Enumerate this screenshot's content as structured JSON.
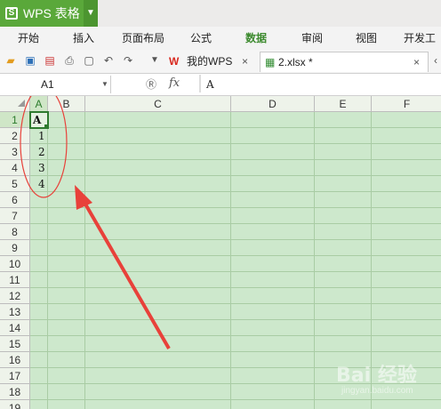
{
  "titlebar": {
    "app_title": "WPS 表格",
    "logo_letter": "S"
  },
  "menu": [
    "开始",
    "插入",
    "页面布局",
    "公式",
    "数据",
    "审阅",
    "视图",
    "开发工具"
  ],
  "menu_active": "数据",
  "toolbar": {
    "tabs": [
      {
        "label": "我的WPS"
      },
      {
        "label": "2.xlsx *"
      }
    ]
  },
  "formula_bar": {
    "name_box": "A1",
    "fx_label": "fx",
    "content": "A"
  },
  "sheet": {
    "columns": [
      "A",
      "B",
      "C",
      "D",
      "E",
      "F"
    ],
    "rows": [
      "1",
      "2",
      "3",
      "4",
      "5",
      "6",
      "7",
      "8",
      "9",
      "10",
      "11",
      "12",
      "13",
      "14",
      "15",
      "16",
      "17",
      "18",
      "19"
    ],
    "cells": {
      "A1": "A",
      "A2": "1",
      "A3": "2",
      "A4": "3",
      "A5": "4"
    }
  },
  "watermark": {
    "text": "Bai 经验",
    "subtext": "jingyan.baidu.com"
  },
  "colors": {
    "brand_green": "#5aa83a",
    "grid_bg": "#cde8cc",
    "annotation_red": "#e8413a"
  }
}
